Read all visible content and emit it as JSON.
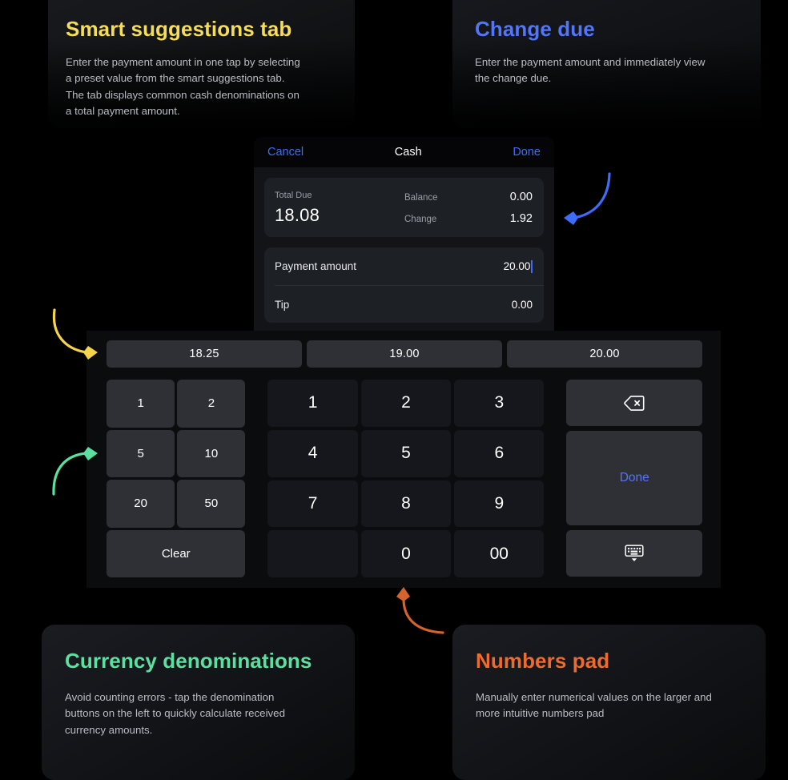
{
  "cards": {
    "smart_suggestions": {
      "title": "Smart suggestions tab",
      "body": "Enter the payment amount in one tap by selecting\na preset value from the smart suggestions tab.\nThe tab displays common cash denominations on\na total payment amount.",
      "accent": "#f5dd5a"
    },
    "change_due": {
      "title": "Change due",
      "body": "Enter the payment amount and immediately view\nthe change due.",
      "accent": "#5276f5"
    },
    "currency_denominations": {
      "title": "Currency denominations",
      "body": "Avoid counting errors - tap the denomination\nbuttons on the left to quickly calculate received\ncurrency amounts.",
      "accent": "#5ce0a0"
    },
    "numbers_pad": {
      "title": "Numbers pad",
      "body": "Manually enter numerical values on the larger and\nmore intuitive numbers pad",
      "accent": "#ec6b2d"
    }
  },
  "dialog": {
    "cancel_label": "Cancel",
    "title": "Cash",
    "done_label": "Done",
    "totals": {
      "total_due_label": "Total Due",
      "total_due_value": "18.08",
      "balance_label": "Balance",
      "balance_value": "0.00",
      "change_label": "Change",
      "change_value": "1.92"
    },
    "fields": [
      {
        "label": "Payment amount",
        "value": "20.00",
        "focused": true
      },
      {
        "label": "Tip",
        "value": "0.00",
        "focused": false
      }
    ]
  },
  "keypad": {
    "suggestions": [
      "18.25",
      "19.00",
      "20.00"
    ],
    "denominations": [
      "1",
      "2",
      "5",
      "10",
      "20",
      "50"
    ],
    "clear_label": "Clear",
    "numbers": [
      "1",
      "2",
      "3",
      "4",
      "5",
      "6",
      "7",
      "8",
      "9",
      "",
      "0",
      "00"
    ],
    "actions": {
      "backspace_icon": "backspace-icon",
      "done_label": "Done",
      "dismiss_keyboard_icon": "keyboard-dismiss-icon"
    }
  },
  "annotations": [
    {
      "name": "arrow-to-change-due",
      "color": "#3d6dfa"
    },
    {
      "name": "arrow-to-suggestions",
      "color": "#f5d34a"
    },
    {
      "name": "arrow-to-denominations",
      "color": "#5ce0a0"
    },
    {
      "name": "arrow-to-numbers-pad",
      "color": "#d4632c"
    }
  ]
}
